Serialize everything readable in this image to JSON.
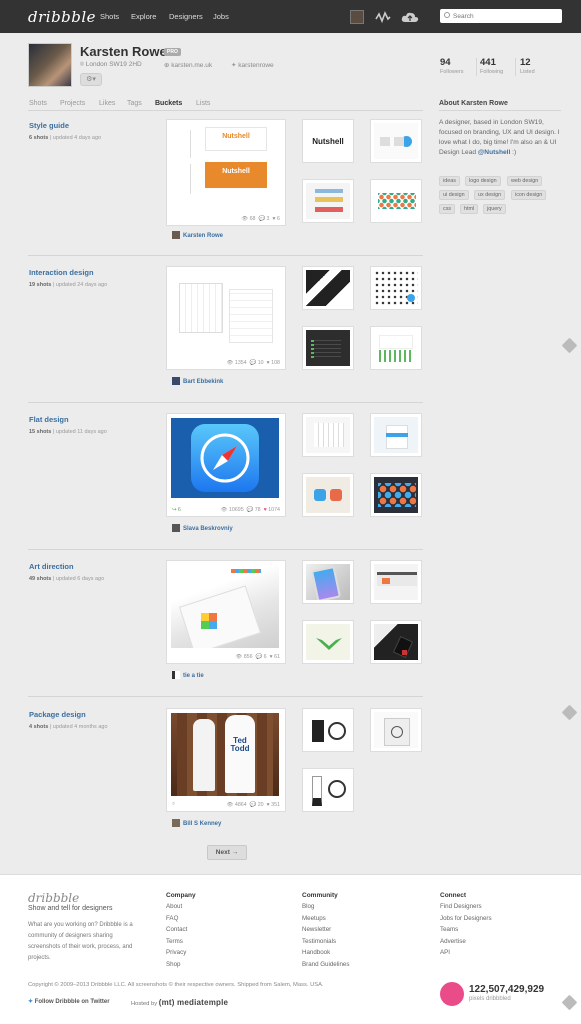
{
  "header": {
    "logo": "dribbble",
    "nav": [
      "Shots",
      "Explore",
      "Designers",
      "Jobs"
    ],
    "search_placeholder": "Search"
  },
  "profile": {
    "name": "Karsten Rowe",
    "badge": "PRO",
    "location": "London SW19 2HD",
    "website": "karsten.me.uk",
    "twitter": "karstenrowe",
    "stats": [
      {
        "num": "94",
        "label": "Followers"
      },
      {
        "num": "441",
        "label": "Following"
      },
      {
        "num": "12",
        "label": "Listed"
      }
    ]
  },
  "tabs": [
    "Shots",
    "Projects",
    "Likes",
    "Tags",
    "Buckets",
    "Lists"
  ],
  "active_tab": "Buckets",
  "about": {
    "title": "About Karsten Rowe",
    "text": "A designer, based in London SW19, focused on branding, UX and UI design. I love what I do, big time! I'm also an  & UI Design Lead",
    "link": "@Nutshell",
    "tail": " :)",
    "tags": [
      "ideas",
      "logo design",
      "web design",
      "ui design",
      "ux design",
      "icon design",
      "css",
      "html",
      "jquery"
    ]
  },
  "buckets": [
    {
      "title": "Style guide",
      "shots": "6 shots",
      "updated": "updated 4 days ago",
      "views": "68",
      "comments": "3",
      "likes": "6",
      "rebounds": "",
      "author": "Karsten Rowe"
    },
    {
      "title": "Interaction design",
      "shots": "19 shots",
      "updated": "updated 24 days ago",
      "views": "1354",
      "comments": "10",
      "likes": "108",
      "rebounds": "",
      "author": "Bart Ebbekink"
    },
    {
      "title": "Flat design",
      "shots": "15 shots",
      "updated": "updated 11 days ago",
      "views": "10695",
      "comments": "78",
      "likes": "1074",
      "rebounds": "6",
      "author": "Slava Beskrovniy"
    },
    {
      "title": "Art direction",
      "shots": "49 shots",
      "updated": "updated 6 days ago",
      "views": "856",
      "comments": "6",
      "likes": "61",
      "rebounds": "",
      "author": "tie a tie"
    },
    {
      "title": "Package design",
      "shots": "4 shots",
      "updated": "updated 4 months ago",
      "views": "4864",
      "comments": "20",
      "likes": "351",
      "rebounds": "",
      "author": "Bill S Kenney"
    }
  ],
  "shot_text": {
    "nutshell": "Nutshell",
    "nutshell_sub": "Nutshell",
    "ted_todd": "Ted Todd"
  },
  "pagination": {
    "next": "Next →"
  },
  "footer": {
    "logo": "dribbble",
    "tagline": "Show and tell for designers",
    "desc": "What are you working on? Dribbble is a community of designers sharing screenshots of their work, process, and projects.",
    "columns": [
      {
        "title": "Company",
        "links": [
          "About",
          "FAQ",
          "Contact",
          "Terms",
          "Privacy",
          "Shop"
        ]
      },
      {
        "title": "Community",
        "links": [
          "Blog",
          "Meetups",
          "Newsletter",
          "Testimonials",
          "Handbook",
          "Brand Guidelines"
        ]
      },
      {
        "title": "Connect",
        "links": [
          "Find Designers",
          "Jobs for Designers",
          "Teams",
          "Advertise",
          "API"
        ]
      }
    ],
    "copyright": "Copyright © 2009–2013 Dribbble LLC. All screenshots © their respective owners. Shipped from Salem, Mass. USA.",
    "follow": "Follow Dribbble on Twitter",
    "hosted": "Hosted by",
    "host_name": "(mt) mediatemple",
    "count": "122,507,429,929",
    "count_label": "pixels dribbbled"
  },
  "colors": {
    "link": "#3b6fa0",
    "topbar": "#333333",
    "pink": "#ea4c89"
  }
}
